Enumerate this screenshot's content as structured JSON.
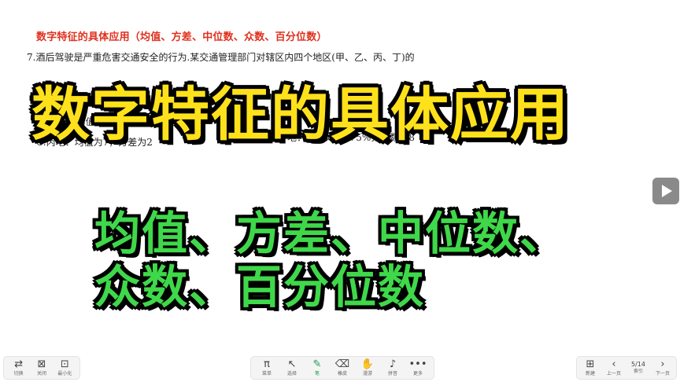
{
  "document": {
    "title": "数字特征的具体应用（均值、方差、中位数、众数、百分位数）",
    "lines": [
      "7.酒后驾驶是严重危害交通安全的行为.某交通管理部门对辖区内四个地区(甲、乙、丙、丁)的",
      "B.乙地：均值为4，中位数为4",
      "C.丙地：均值为7，方差为2",
      "D.丁地：极差为3，75%分位数为8"
    ]
  },
  "overlay": {
    "headline": "数字特征的具体应用",
    "subline_1": "均值、方差、中位数、",
    "subline_2": "众数、百分位数"
  },
  "toolbar_left": {
    "items": [
      {
        "icon": "⇄",
        "label": "切换"
      },
      {
        "icon": "⊠",
        "label": "关闭"
      },
      {
        "icon": "⊡",
        "label": "最小化"
      }
    ]
  },
  "toolbar_center": {
    "items": [
      {
        "icon": "π",
        "label": "菜单"
      },
      {
        "icon": "↖",
        "label": "选择"
      },
      {
        "icon": "✎",
        "label": "笔"
      },
      {
        "icon": "⌫",
        "label": "橡皮"
      },
      {
        "icon": "✋",
        "label": "漫游"
      },
      {
        "icon": "♪",
        "label": "拼音"
      },
      {
        "icon": "•••",
        "label": "更多"
      }
    ]
  },
  "toolbar_right": {
    "new_page": {
      "icon": "⊞",
      "label": "新建"
    },
    "prev": {
      "icon": "‹",
      "label": "上一页"
    },
    "page_indicator": "5/14",
    "index_label": "索引",
    "next": {
      "icon": "›",
      "label": "下一页"
    }
  },
  "colors": {
    "title_red": "#e0301e",
    "headline_yellow": "#ffe11b",
    "subline_green": "#3fd84a",
    "active_tool_green": "#1e9b4a"
  }
}
